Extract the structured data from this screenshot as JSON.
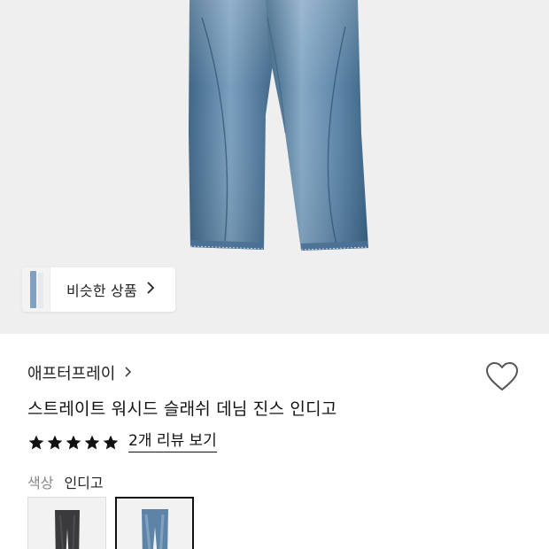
{
  "product_image": {
    "similar_products_label": "비슷한 상품"
  },
  "product": {
    "brand": "애프터프레이",
    "title": "스트레이트 워시드 슬래쉬 데님 진스 인디고",
    "rating": 5,
    "rating_max": 5,
    "review_link": "2개 리뷰 보기"
  },
  "options": {
    "color_label": "색상",
    "color_value": "인디고",
    "swatches": [
      {
        "name": "washed black",
        "color": "#3a3a3c",
        "selected": false
      },
      {
        "name": "indigo",
        "color": "#5d83a6",
        "selected": true
      }
    ]
  },
  "icons": {
    "brand_chevron": "chevron-right-icon",
    "similar_chevron": "chevron-right-icon",
    "wishlist": "heart-outline-icon",
    "star": "star-filled-icon"
  },
  "colors": {
    "hero_background": "#efefef",
    "denim_light": "#6f95b6",
    "denim_dark": "#2f5578",
    "text_primary": "#111111",
    "text_muted": "#888888"
  }
}
